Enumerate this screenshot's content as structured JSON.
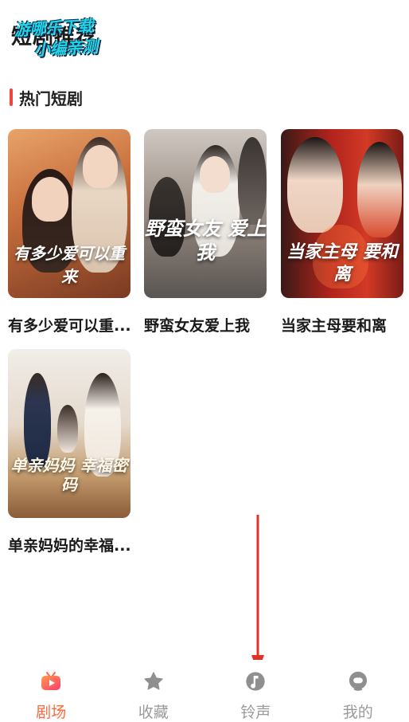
{
  "header": {
    "title": "短剧推荐",
    "watermark_line1": "游哪乐下载",
    "watermark_line2": "小编亲测"
  },
  "section": {
    "title": "热门短剧"
  },
  "dramas": [
    {
      "title": "有多少爱可以重...",
      "poster_art": "有多少爱可以重来"
    },
    {
      "title": "野蛮女友爱上我",
      "poster_art": "野蛮女友 爱上我"
    },
    {
      "title": "当家主母要和离",
      "poster_art": "当家主母 要和离"
    },
    {
      "title": "单亲妈妈的幸福...",
      "poster_art": "单亲妈妈 幸福密码"
    }
  ],
  "tabbar": {
    "tabs": [
      {
        "label": "剧场",
        "icon": "theater-icon",
        "active": true
      },
      {
        "label": "收藏",
        "icon": "star-icon",
        "active": false
      },
      {
        "label": "铃声",
        "icon": "ringtone-icon",
        "active": false
      },
      {
        "label": "我的",
        "icon": "profile-icon",
        "active": false
      }
    ]
  },
  "colors": {
    "accent": "#ff6a3d",
    "section_bar": "#f0463c",
    "inactive": "#9a9a9a",
    "annotation_arrow": "#e0322b"
  }
}
